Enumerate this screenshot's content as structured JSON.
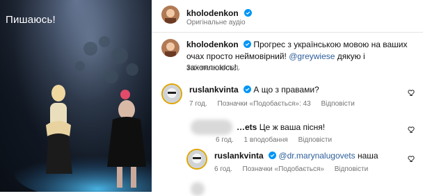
{
  "media": {
    "caption": "Пишаюсь!"
  },
  "header": {
    "username": "kholodenkon",
    "audio": "Оригінальне аудіо"
  },
  "post": {
    "username": "kholodenkon",
    "text_before": "Прогрес з українською мовою на ваших очах просто неймовірний! ",
    "mention": "@greywiese",
    "text_after": " дякую і захоплююсь!",
    "meta": "Змінено · 14 год."
  },
  "comments": [
    {
      "username": "ruslankvinta",
      "text": "А що з правами?",
      "time": "7 год.",
      "likes": "Позначки «Подобається»: 43",
      "reply": "Відповісти"
    },
    {
      "username": "…ets",
      "text": "Це ж ваша пісня!",
      "time": "6 год.",
      "likes": "1 вподобання",
      "reply": "Відповісти"
    },
    {
      "username": "ruslankvinta",
      "mention": "@dr.marynalugovets",
      "text": " наша",
      "time": "6 год.",
      "likes": "Позначки «Подобається»",
      "reply": "Відповісти"
    }
  ],
  "colors": {
    "verified": "#0095f6",
    "mention": "#2c5e9a"
  }
}
